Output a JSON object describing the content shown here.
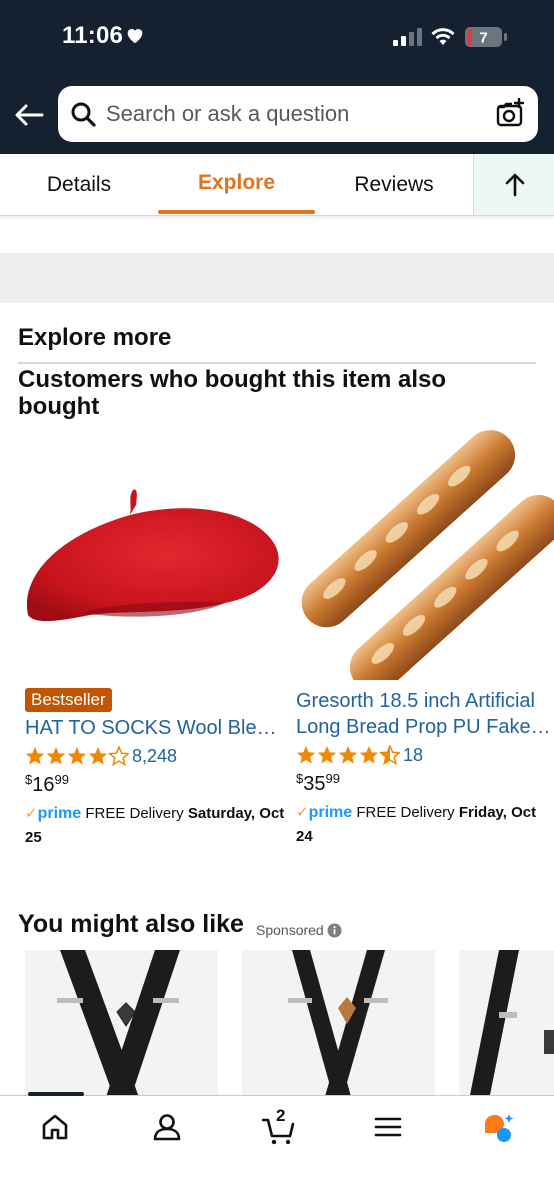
{
  "status_bar": {
    "time": "11:06",
    "battery": "7"
  },
  "search": {
    "placeholder": "Search or ask a question"
  },
  "tabs": [
    {
      "label": "Details"
    },
    {
      "label": "Explore",
      "active": true
    },
    {
      "label": "Reviews"
    }
  ],
  "explore": {
    "title": "Explore more",
    "section_title": "Customers who bought this item also bought",
    "products": [
      {
        "badge": "Bestseller",
        "title": "HAT TO SOCKS Wool Blend French Beret",
        "title_visible": "HAT TO SOCKS Wool Ble…",
        "rating": 4.0,
        "rating_count": "8,248",
        "price_symbol": "$",
        "price_whole": "16",
        "price_cents": "99",
        "prime_logo": "prime",
        "delivery_prefix": "FREE Delivery",
        "delivery_date": "Saturday, Oct 25"
      },
      {
        "badge": "",
        "title_line1": "Gresorth 18.5 inch Artificial",
        "title_line2": "Long Bread Prop PU Fake…",
        "rating": 4.5,
        "rating_count": "18",
        "price_symbol": "$",
        "price_whole": "35",
        "price_cents": "99",
        "prime_logo": "prime",
        "delivery_prefix": "FREE Delivery",
        "delivery_date": "Friday, Oct 24"
      }
    ]
  },
  "you_might_also_like": {
    "title": "You might also like",
    "sponsored": "Sponsored"
  },
  "bottom_nav": {
    "items": [
      "home-icon",
      "account-icon",
      "cart-icon",
      "menu-icon",
      "rufus-ai-icon"
    ],
    "cart_count": "2"
  },
  "colors": {
    "header_bg": "#152130",
    "accent_orange": "#e4731d",
    "link_blue": "#2162a1",
    "star_orange": "#f08804",
    "badge_bg": "#c45500",
    "prime_blue": "#1a98ff"
  }
}
